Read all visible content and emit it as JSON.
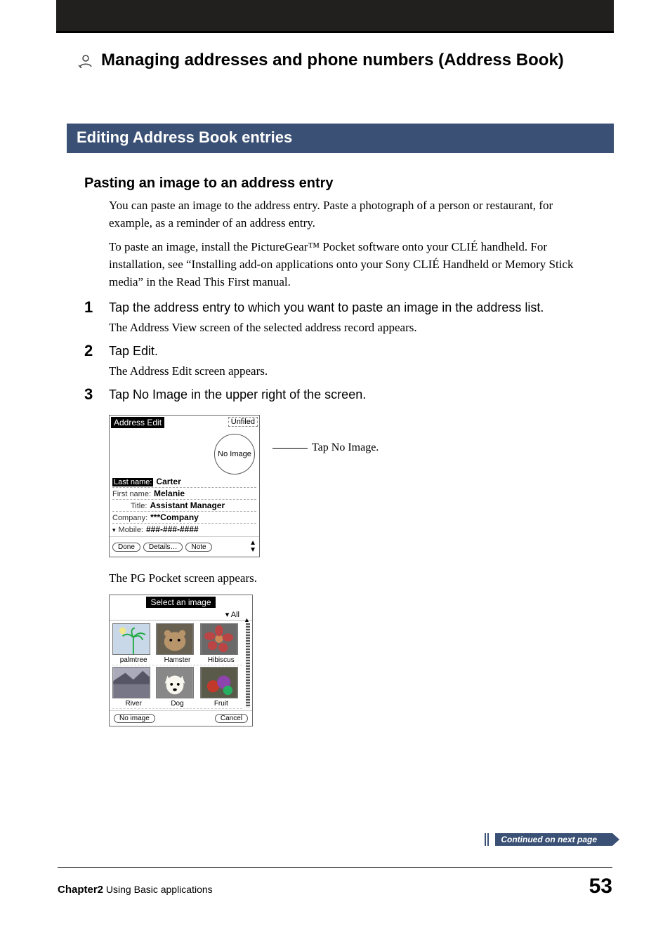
{
  "chapter_title": "Managing addresses and phone numbers (Address Book)",
  "section_title": "Editing Address Book entries",
  "subheading": "Pasting an image to an address entry",
  "intro_p1": "You can paste an image to the address entry. Paste a photograph of a person or restaurant, for example, as a reminder of an address entry.",
  "intro_p2": "To paste an image, install the PictureGear™ Pocket software onto your CLIÉ handheld. For installation, see “Installing add-on applications onto your Sony CLIÉ Handheld or Memory Stick media” in the Read This First manual.",
  "steps": [
    {
      "num": "1",
      "title": "Tap the address entry to which you want to paste an image in the address list.",
      "sub": "The Address View screen of the selected address record appears."
    },
    {
      "num": "2",
      "title": "Tap Edit.",
      "sub": "The Address Edit screen appears."
    },
    {
      "num": "3",
      "title": "Tap No Image in the upper right of the screen.",
      "sub": ""
    }
  ],
  "address_edit_screen": {
    "title": "Address Edit",
    "category": "Unfiled",
    "no_image_label": "No Image",
    "fields": {
      "last_name_label": "Last name:",
      "last_name_value": "Carter",
      "first_name_label": "First name:",
      "first_name_value": "Melanie",
      "title_label": "Title:",
      "title_value": "Assistant Manager",
      "company_label": "Company:",
      "company_value": "***Company",
      "mobile_label": "Mobile:",
      "mobile_value": "###-###-####"
    },
    "buttons": {
      "done": "Done",
      "details": "Details…",
      "note": "Note"
    }
  },
  "callout_text": "Tap No Image.",
  "after_screen_text": "The PG Pocket screen appears.",
  "select_image_screen": {
    "title": "Select an image",
    "filter": "▾ All",
    "thumbs": [
      "palmtree",
      "Hamster",
      "Hibiscus",
      "River",
      "Dog",
      "Fruit"
    ],
    "buttons": {
      "noimage": "No image",
      "cancel": "Cancel"
    }
  },
  "continued_text": "Continued on next page",
  "footer": {
    "chapter_bold": "Chapter2",
    "chapter_rest": "  Using Basic applications",
    "page": "53"
  }
}
